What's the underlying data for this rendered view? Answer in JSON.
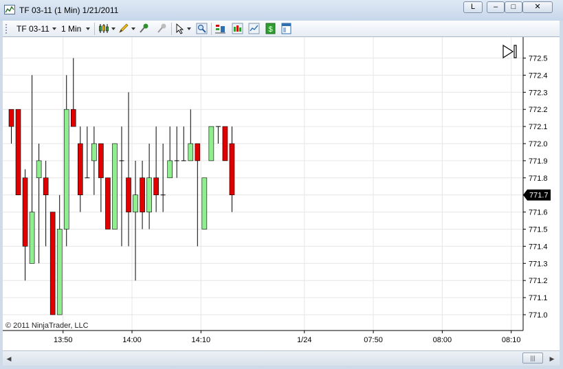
{
  "window": {
    "title": "TF 03-11 (1 Min)  1/21/2011",
    "buttons": {
      "link": "L",
      "minimize": "–",
      "maximize": "□",
      "close": "✕"
    }
  },
  "toolbar": {
    "instrument": "TF 03-11",
    "interval": "1 Min",
    "icons": [
      "chart-style-icon",
      "drawing-tools-icon",
      "pin-icon",
      "unpin-icon",
      "cursor-icon",
      "zoom-icon",
      "strategies-icon",
      "indicators-icon",
      "data-series-icon",
      "dollar-icon",
      "properties-icon"
    ]
  },
  "copyright": "© 2011 NinjaTrader, LLC",
  "scrollbar": {
    "thumb_label": "|||"
  },
  "colors": {
    "up": "#90ee90",
    "down": "#e00000",
    "wick": "#000000",
    "grid": "#e6e6e6",
    "price_tag": "#000000"
  },
  "chart_data": {
    "type": "candlestick",
    "instrument": "TF 03-11",
    "interval": "1 Min",
    "ylim": [
      770.96,
      772.62
    ],
    "y_ticks": [
      772.5,
      772.4,
      772.3,
      772.2,
      772.1,
      772.0,
      771.9,
      771.8,
      771.7,
      771.6,
      771.5,
      771.4,
      771.3,
      771.2,
      771.1,
      771.0
    ],
    "y_tick_labels": [
      "772.5",
      "772.4",
      "772.3",
      "772.2",
      "772.1",
      "772.0",
      "771.9",
      "771.8",
      "771.7",
      "771.6",
      "771.5",
      "771.4",
      "771.3",
      "771.2",
      "771.1",
      "771.0"
    ],
    "current_price": "771.7",
    "x_ticks": [
      {
        "label": "13:50",
        "slot": 7.5
      },
      {
        "label": "14:00",
        "slot": 17.5
      },
      {
        "label": "14:10",
        "slot": 27.5
      },
      {
        "label": "1/24",
        "slot": 42.5
      },
      {
        "label": "07:50",
        "slot": 52.5
      },
      {
        "label": "08:00",
        "slot": 62.5
      },
      {
        "label": "08:10",
        "slot": 72.5
      }
    ],
    "candles": [
      {
        "o": 772.2,
        "h": 772.2,
        "l": 772.0,
        "c": 772.1
      },
      {
        "o": 772.2,
        "h": 772.2,
        "l": 771.7,
        "c": 771.7
      },
      {
        "o": 771.8,
        "h": 771.85,
        "l": 771.2,
        "c": 771.4
      },
      {
        "o": 771.3,
        "h": 772.4,
        "l": 771.3,
        "c": 771.6
      },
      {
        "o": 771.8,
        "h": 772.0,
        "l": 771.3,
        "c": 771.9
      },
      {
        "o": 771.8,
        "h": 771.9,
        "l": 771.4,
        "c": 771.7
      },
      {
        "o": 771.6,
        "h": 771.6,
        "l": 771.0,
        "c": 771.0
      },
      {
        "o": 771.0,
        "h": 771.7,
        "l": 771.0,
        "c": 771.5
      },
      {
        "o": 771.5,
        "h": 772.4,
        "l": 771.4,
        "c": 772.2
      },
      {
        "o": 772.2,
        "h": 772.5,
        "l": 772.1,
        "c": 772.1
      },
      {
        "o": 772.0,
        "h": 772.1,
        "l": 771.6,
        "c": 771.7
      },
      {
        "o": 771.8,
        "h": 772.1,
        "l": 771.8,
        "c": 771.8
      },
      {
        "o": 771.9,
        "h": 772.1,
        "l": 771.7,
        "c": 772.0
      },
      {
        "o": 772.0,
        "h": 772.0,
        "l": 771.6,
        "c": 771.8
      },
      {
        "o": 771.8,
        "h": 771.8,
        "l": 771.5,
        "c": 771.5
      },
      {
        "o": 771.5,
        "h": 772.0,
        "l": 771.5,
        "c": 772.0
      },
      {
        "o": 771.9,
        "h": 772.1,
        "l": 771.4,
        "c": 771.9
      },
      {
        "o": 771.8,
        "h": 772.3,
        "l": 771.4,
        "c": 771.6
      },
      {
        "o": 771.6,
        "h": 771.9,
        "l": 771.2,
        "c": 771.7
      },
      {
        "o": 771.8,
        "h": 771.9,
        "l": 771.5,
        "c": 771.6
      },
      {
        "o": 771.6,
        "h": 772.0,
        "l": 771.5,
        "c": 771.8
      },
      {
        "o": 771.8,
        "h": 772.1,
        "l": 771.6,
        "c": 771.7
      },
      {
        "o": 771.7,
        "h": 772.0,
        "l": 771.6,
        "c": 771.7
      },
      {
        "o": 771.8,
        "h": 772.1,
        "l": 771.8,
        "c": 771.9
      },
      {
        "o": 771.9,
        "h": 772.1,
        "l": 771.8,
        "c": 771.9
      },
      {
        "o": 771.9,
        "h": 772.1,
        "l": 771.9,
        "c": 771.9
      },
      {
        "o": 771.9,
        "h": 772.2,
        "l": 771.9,
        "c": 772.0
      },
      {
        "o": 772.0,
        "h": 772.0,
        "l": 771.4,
        "c": 771.9
      },
      {
        "o": 771.5,
        "h": 771.8,
        "l": 771.5,
        "c": 771.8
      },
      {
        "o": 771.9,
        "h": 772.1,
        "l": 771.9,
        "c": 772.1
      },
      {
        "o": 772.1,
        "h": 772.1,
        "l": 772.0,
        "c": 772.1
      },
      {
        "o": 772.1,
        "h": 772.1,
        "l": 771.9,
        "c": 771.9
      },
      {
        "o": 772.0,
        "h": 772.1,
        "l": 771.6,
        "c": 771.7
      }
    ]
  }
}
